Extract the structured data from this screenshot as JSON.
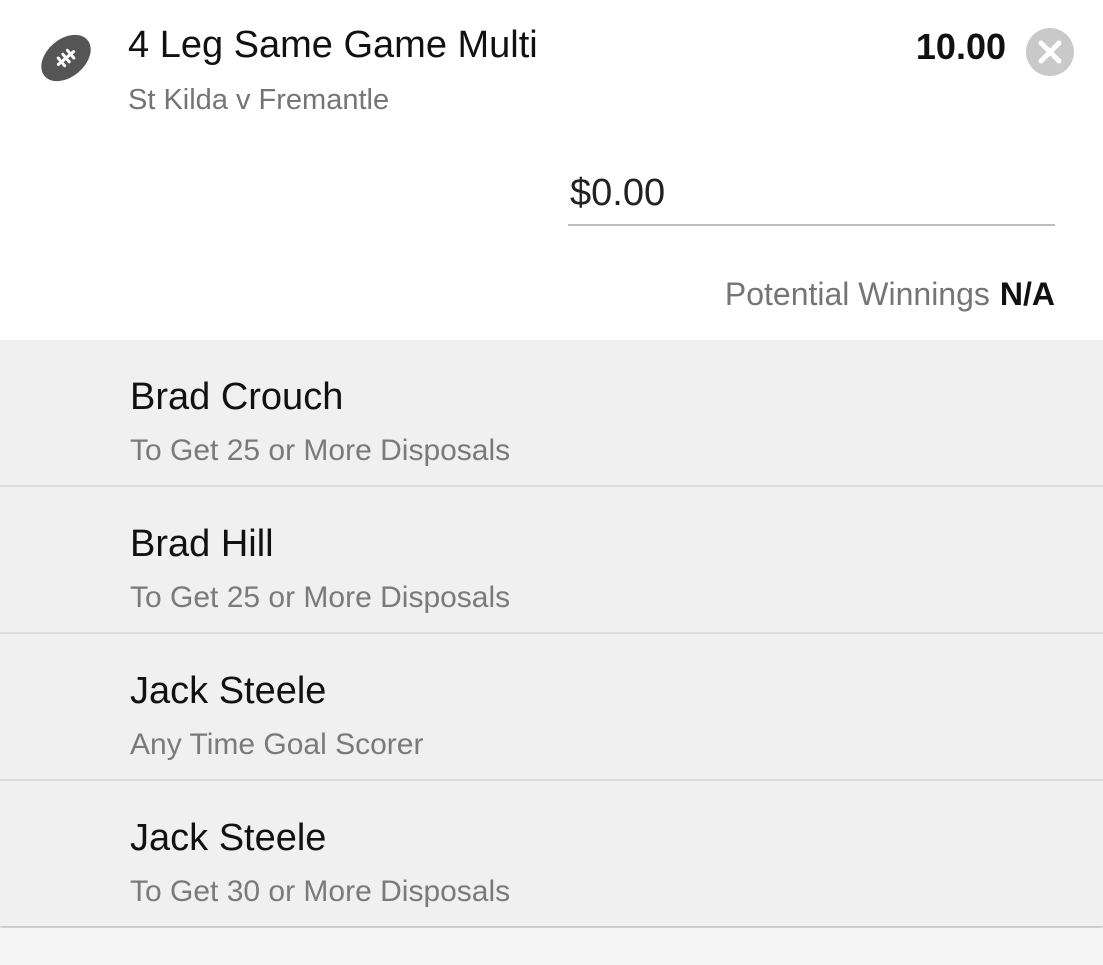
{
  "bet": {
    "sport_icon": "australian-football-icon",
    "title": "4 Leg Same Game Multi",
    "event": "St Kilda v Fremantle",
    "odds": "10.00",
    "remove_icon": "close-icon"
  },
  "stake": {
    "value": "$0.00"
  },
  "winnings": {
    "label": "Potential Winnings",
    "value": "N/A"
  },
  "legs": [
    {
      "name": "Brad Crouch",
      "market": "To Get 25 or More Disposals"
    },
    {
      "name": "Brad Hill",
      "market": "To Get 25 or More Disposals"
    },
    {
      "name": "Jack Steele",
      "market": "Any Time Goal Scorer"
    },
    {
      "name": "Jack Steele",
      "market": "To Get 30 or More Disposals"
    }
  ],
  "colors": {
    "icon": "#555555",
    "header_bg": "#ffffff",
    "legs_bg": "#f0f0f0",
    "secondary_text": "#757575",
    "close_button": "#c9c9c9"
  }
}
